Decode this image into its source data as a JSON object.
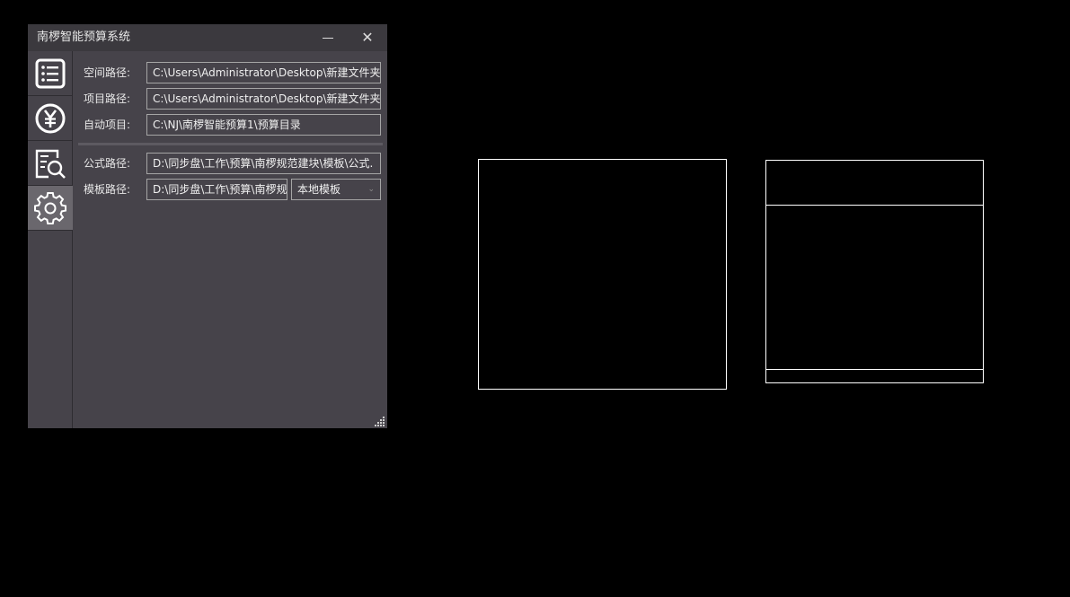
{
  "window": {
    "title": "南椤智能预算系统",
    "minimize_icon": "minimize-icon",
    "close_glyph": "✕"
  },
  "sidebar": {
    "items": [
      {
        "icon": "list-icon",
        "active": false
      },
      {
        "icon": "yuan-currency-icon",
        "active": false
      },
      {
        "icon": "document-search-icon",
        "active": false
      },
      {
        "icon": "gear-icon",
        "active": true
      }
    ]
  },
  "form": {
    "workspace_label": "空间路径:",
    "workspace_value": "C:\\Users\\Administrator\\Desktop\\新建文件夹",
    "project_label": "项目路径:",
    "project_value": "C:\\Users\\Administrator\\Desktop\\新建文件夹",
    "auto_label": "自动项目:",
    "auto_value": "C:\\NJ\\南椤智能预算1\\预算目录",
    "formula_label": "公式路径:",
    "formula_value": "D:\\同步盘\\工作\\预算\\南椤规范建块\\模板\\公式.",
    "template_label": "模板路径:",
    "template_value": "D:\\同步盘\\工作\\预算\\南椤规",
    "template_type_selected": "本地模板"
  },
  "colors": {
    "background": "#000000",
    "panel": "#46434a",
    "titlebar": "#3b393e",
    "active_nav": "#6a676d",
    "cad_lines": "#ffffff"
  }
}
